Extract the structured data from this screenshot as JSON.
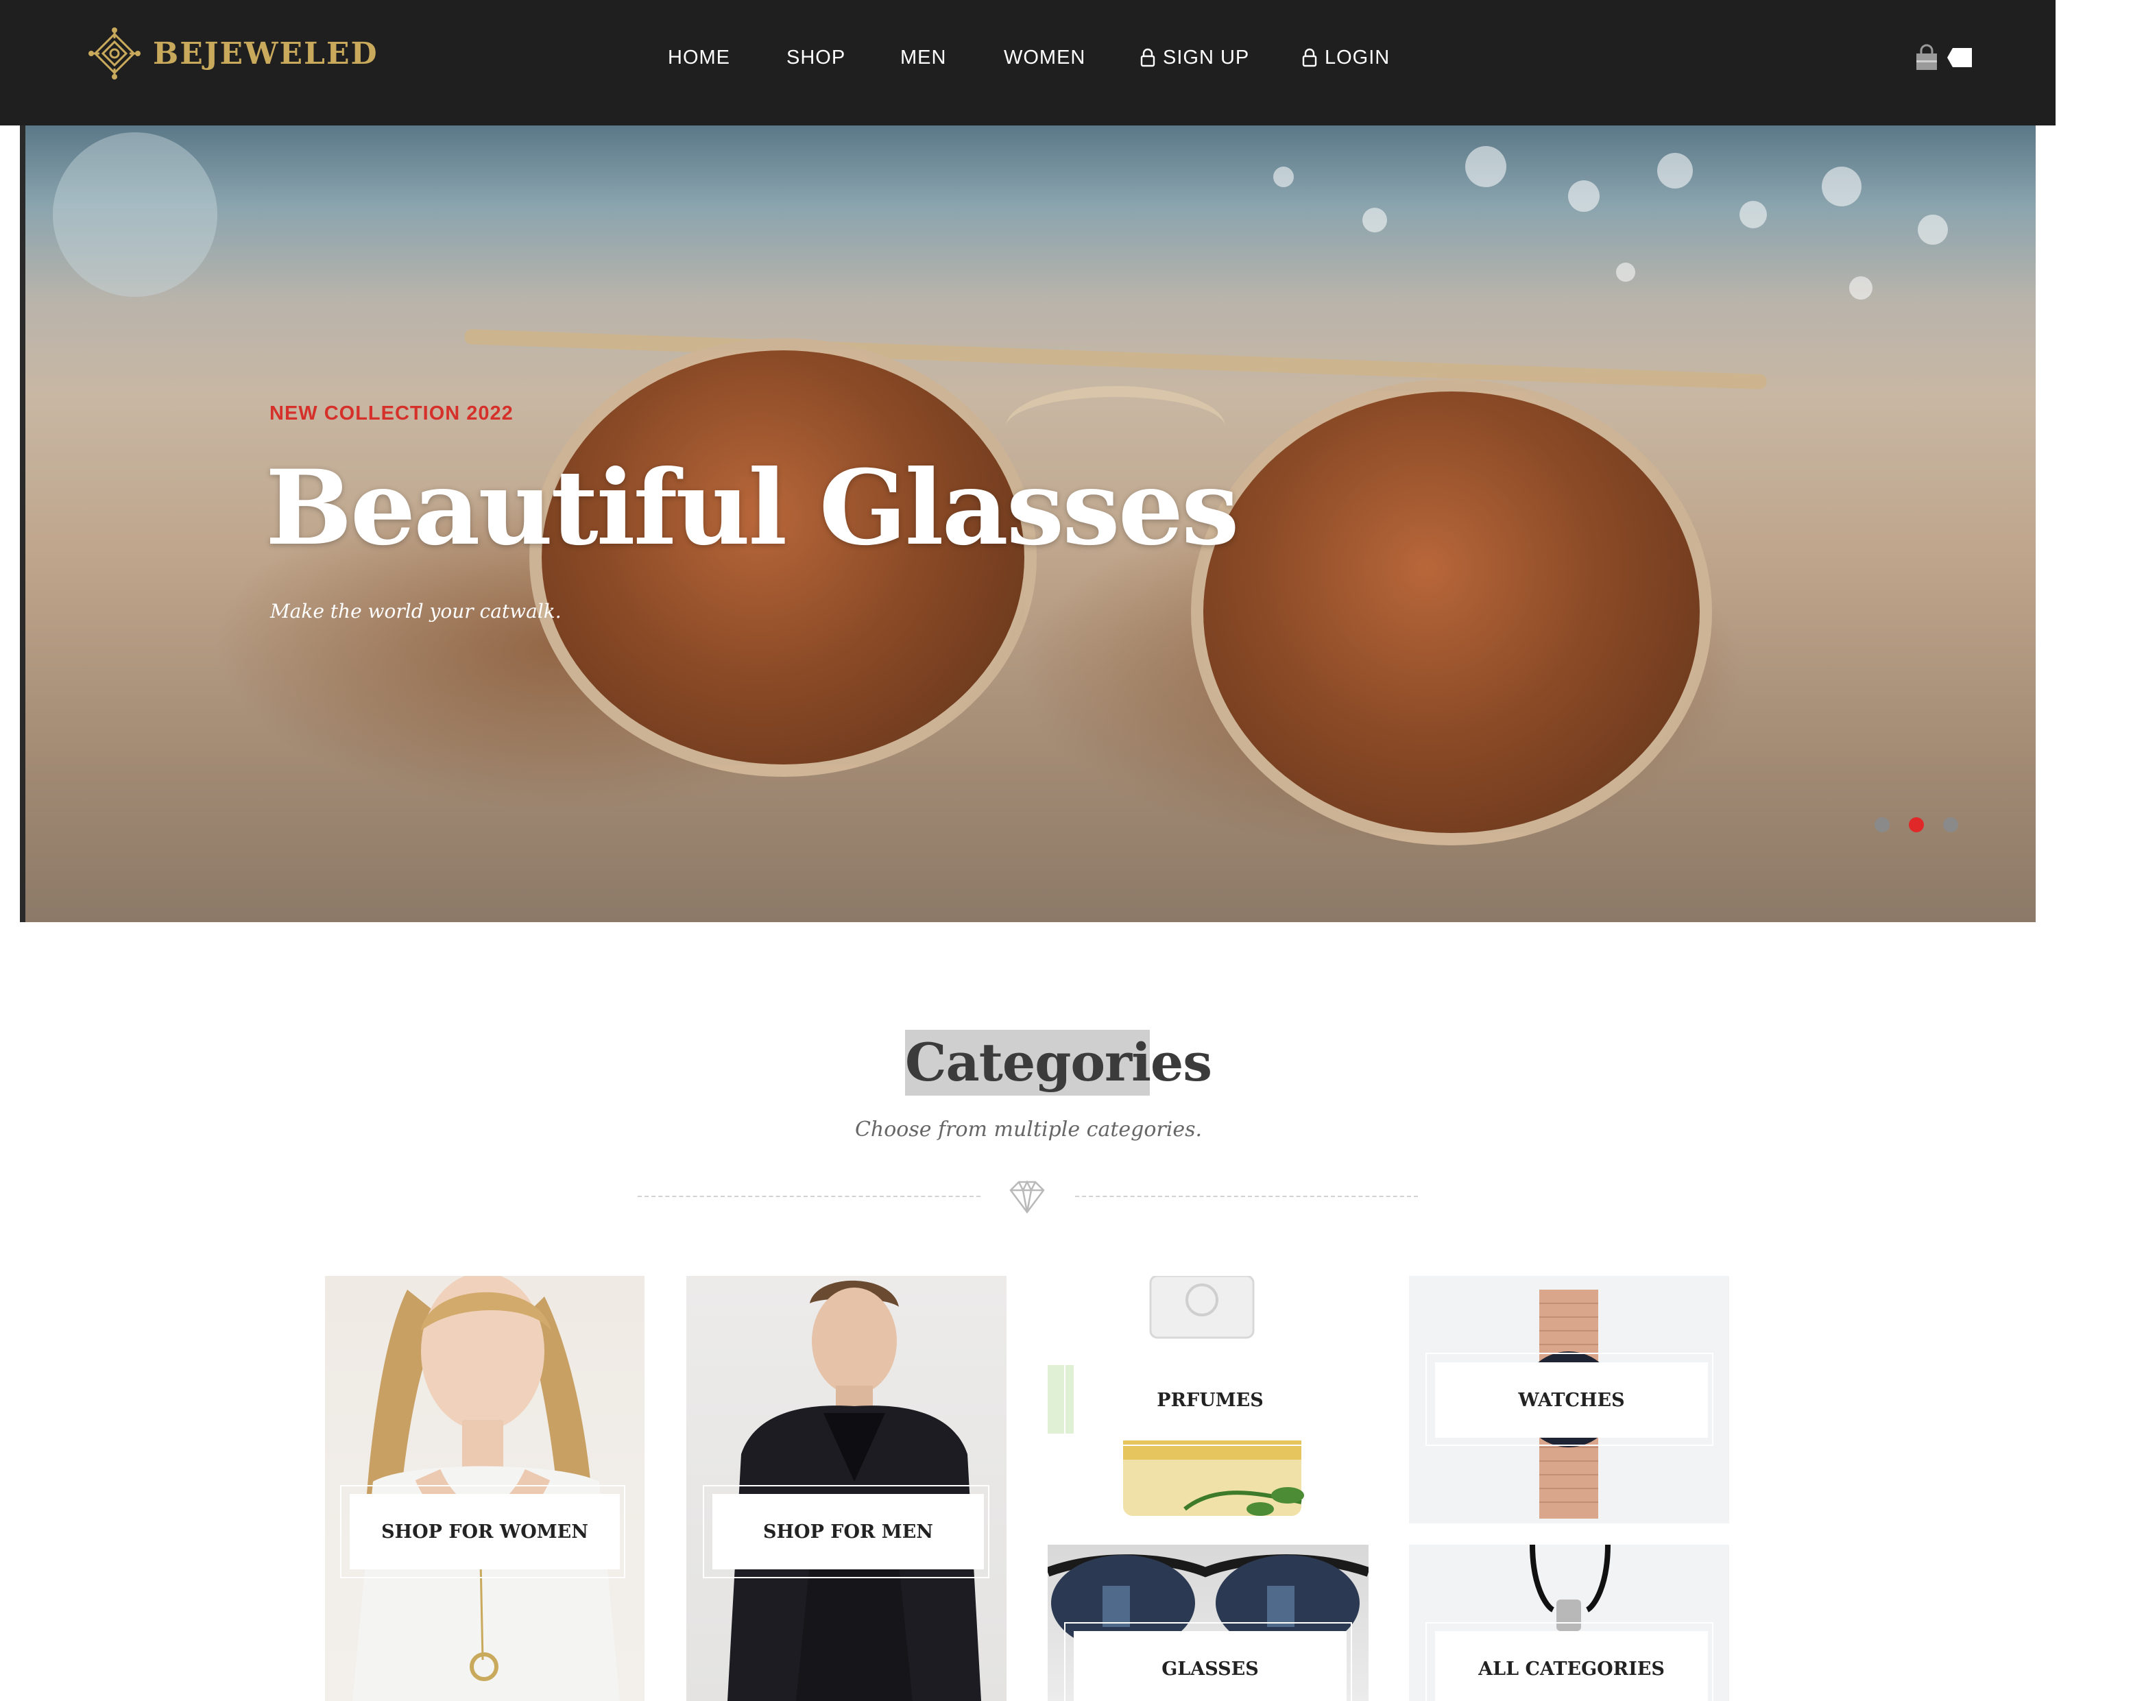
{
  "brand": {
    "name": "BEJEWELED",
    "color": "#c9a95b"
  },
  "nav": {
    "items": [
      {
        "label": "HOME",
        "icon": ""
      },
      {
        "label": "SHOP",
        "icon": ""
      },
      {
        "label": "MEN",
        "icon": ""
      },
      {
        "label": "WOMEN",
        "icon": ""
      },
      {
        "label": "SIGN UP",
        "icon": "lock-icon"
      },
      {
        "label": "LOGIN",
        "icon": "lock-icon"
      }
    ],
    "actions": [
      "shopping-bag-icon",
      "tag-icon"
    ]
  },
  "hero": {
    "eyebrow": "NEW COLLECTION 2022",
    "title": "Beautiful Glasses",
    "subtitle": "Make the world your catwalk.",
    "slides": 3,
    "active_slide": 2,
    "accent": "#d6302b"
  },
  "categories": {
    "title": "Categories",
    "subtitle": "Choose from multiple categories.",
    "divider_icon": "diamond-icon",
    "tiles": [
      {
        "label": "SHOP FOR WOMEN"
      },
      {
        "label": "SHOP FOR MEN"
      },
      {
        "label": "PRFUMES"
      },
      {
        "label": "WATCHES"
      },
      {
        "label": "GLASSES"
      },
      {
        "label": "ALL CATEGORIES"
      }
    ]
  }
}
